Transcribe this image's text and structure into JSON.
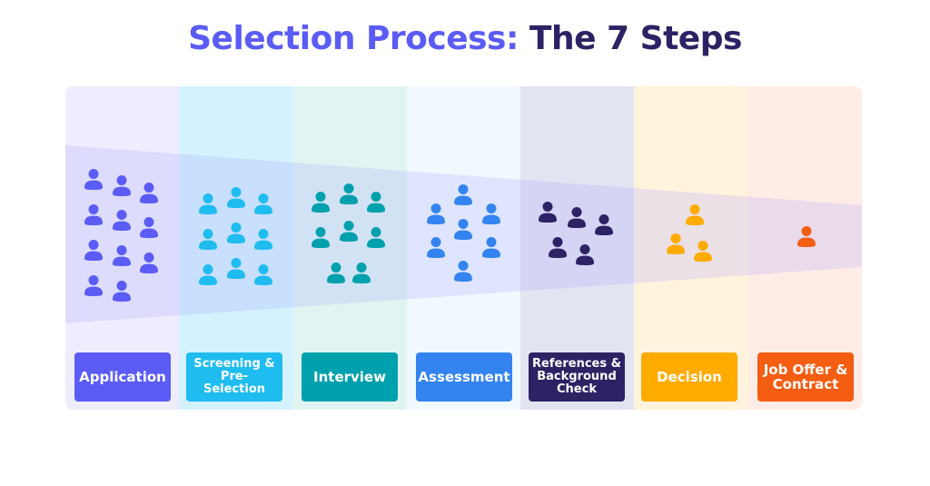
{
  "title": {
    "part1": "Selection Process:",
    "part2": "The 7 Steps"
  },
  "funnel_color": "#9ea0ff",
  "steps": [
    {
      "label": "Application",
      "people": 11,
      "color": "#5b5bf6",
      "bg": "#efedfd",
      "big": true
    },
    {
      "label": "Screening & Pre-Selection",
      "people": 9,
      "color": "#1fbcef",
      "bg": "#d4f1fe",
      "big": false
    },
    {
      "label": "Interview",
      "people": 8,
      "color": "#00a0ac",
      "bg": "#e0f5f2",
      "big": true
    },
    {
      "label": "Assessment",
      "people": 7,
      "color": "#3384f0",
      "bg": "#f1f9fe",
      "big": true
    },
    {
      "label": "References & Background Check",
      "people": 5,
      "color": "#2d2264",
      "bg": "#e3e4f2",
      "big": false
    },
    {
      "label": "Decision",
      "people": 3,
      "color": "#ffab00",
      "bg": "#fff3de",
      "big": true
    },
    {
      "label": "Job Offer & Contract",
      "people": 1,
      "color": "#f45d12",
      "bg": "#ffece6",
      "big": true
    }
  ]
}
